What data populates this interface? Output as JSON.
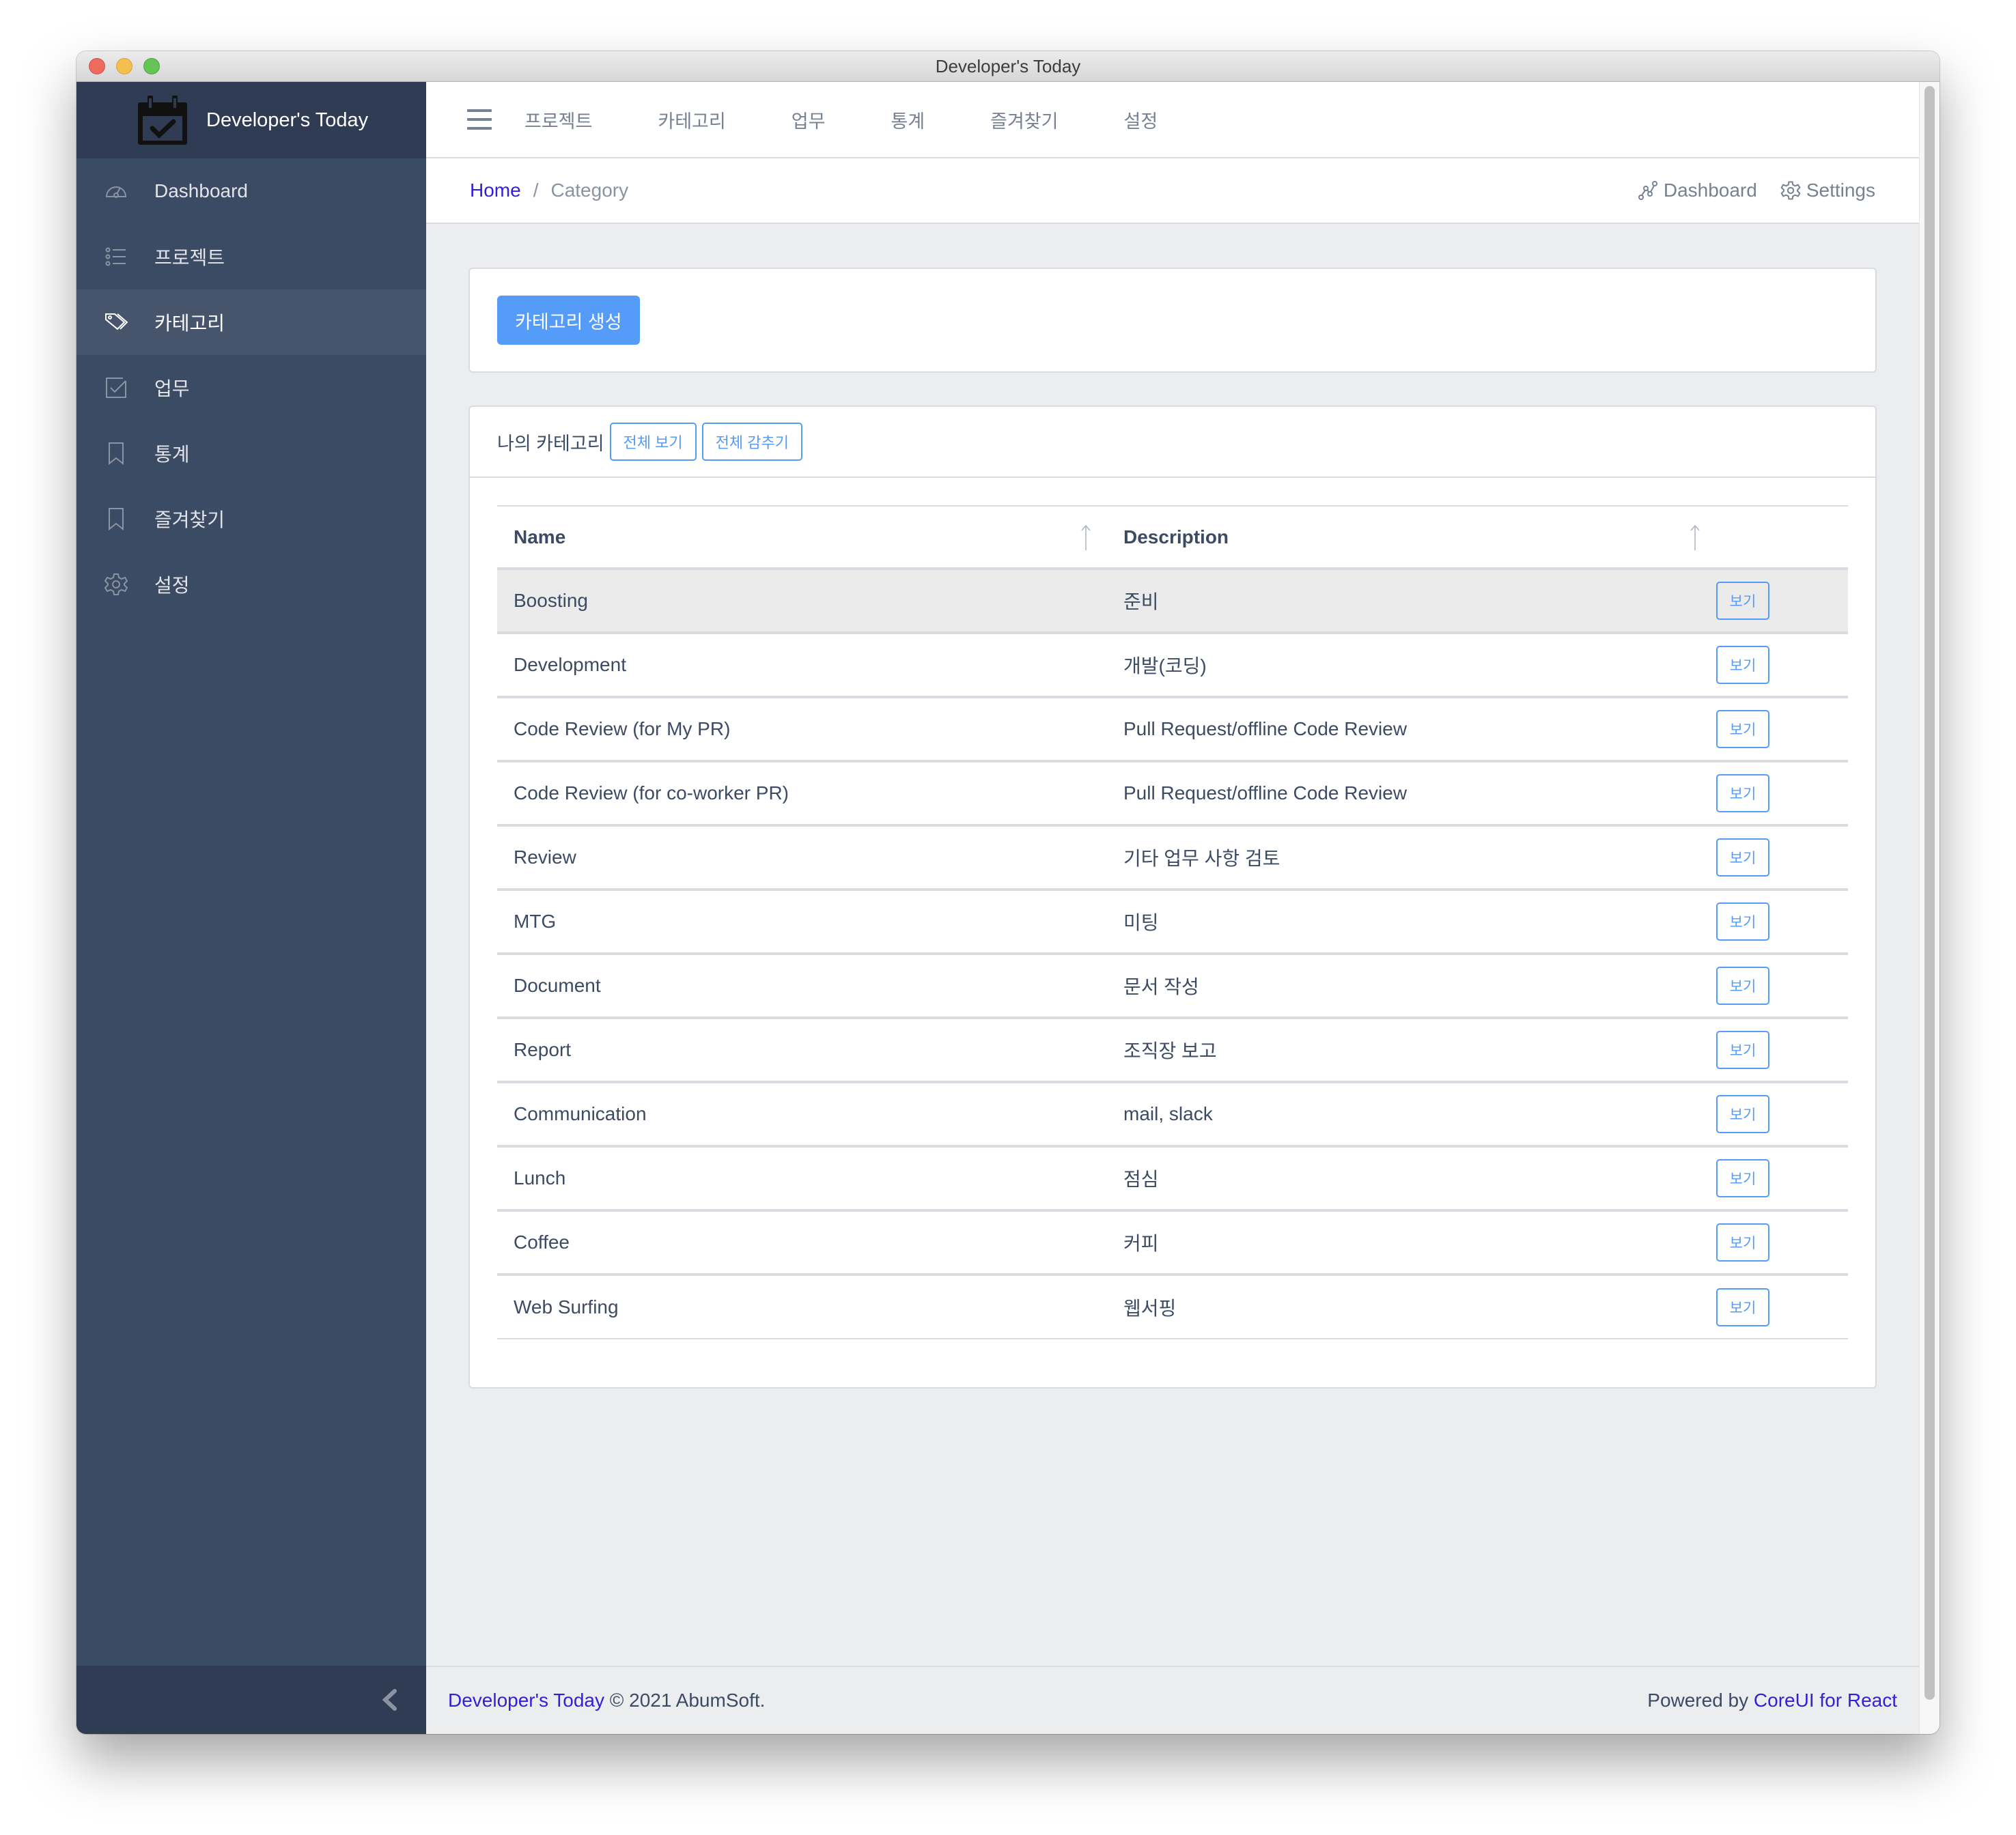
{
  "window": {
    "title": "Developer's Today"
  },
  "sidebar": {
    "brand": "Developer's Today",
    "brand_icon": "calendar-check-icon",
    "items": [
      {
        "label": "Dashboard",
        "icon": "speedometer-icon",
        "active": false
      },
      {
        "label": "프로젝트",
        "icon": "list-icon",
        "active": false
      },
      {
        "label": "카테고리",
        "icon": "tags-icon",
        "active": true
      },
      {
        "label": "업무",
        "icon": "task-icon",
        "active": false
      },
      {
        "label": "통계",
        "icon": "bookmark-icon",
        "active": false
      },
      {
        "label": "즐겨찾기",
        "icon": "bookmark-icon",
        "active": false
      },
      {
        "label": "설정",
        "icon": "settings-icon",
        "active": false
      }
    ],
    "minimize_icon": "chevron-left-icon"
  },
  "header": {
    "nav": [
      "프로젝트",
      "카테고리",
      "업무",
      "통계",
      "즐겨찾기",
      "설정"
    ]
  },
  "breadcrumb": {
    "home": "Home",
    "separator": "/",
    "current": "Category"
  },
  "subheader_actions": {
    "dashboard": "Dashboard",
    "settings": "Settings"
  },
  "create_card": {
    "button": "카테고리 생성"
  },
  "list_card": {
    "title": "나의 카테고리",
    "show_all": "전체 보기",
    "hide_all": "전체 감추기",
    "columns": [
      "Name",
      "Description"
    ],
    "view_label": "보기",
    "rows": [
      {
        "name": "Boosting",
        "description": "준비"
      },
      {
        "name": "Development",
        "description": "개발(코딩)"
      },
      {
        "name": "Code Review (for My PR)",
        "description": "Pull Request/offline Code Review"
      },
      {
        "name": "Code Review (for co-worker PR)",
        "description": "Pull Request/offline Code Review"
      },
      {
        "name": "Review",
        "description": "기타 업무 사항 검토"
      },
      {
        "name": "MTG",
        "description": "미팅"
      },
      {
        "name": "Document",
        "description": "문서 작성"
      },
      {
        "name": "Report",
        "description": "조직장 보고"
      },
      {
        "name": "Communication",
        "description": "mail, slack"
      },
      {
        "name": "Lunch",
        "description": "점심"
      },
      {
        "name": "Coffee",
        "description": "커피"
      },
      {
        "name": "Web Surfing",
        "description": "웹서핑"
      }
    ]
  },
  "footer": {
    "brand_link": "Developer's Today",
    "copyright": "© 2021 AbumSoft.",
    "powered_by": "Powered by",
    "powered_link": "CoreUI for React"
  },
  "colors": {
    "sidebar_bg": "#3c4b64",
    "sidebar_brand_bg": "#303c54",
    "primary": "#559bf8",
    "link": "#321fdb",
    "body_bg": "#ebedef"
  }
}
